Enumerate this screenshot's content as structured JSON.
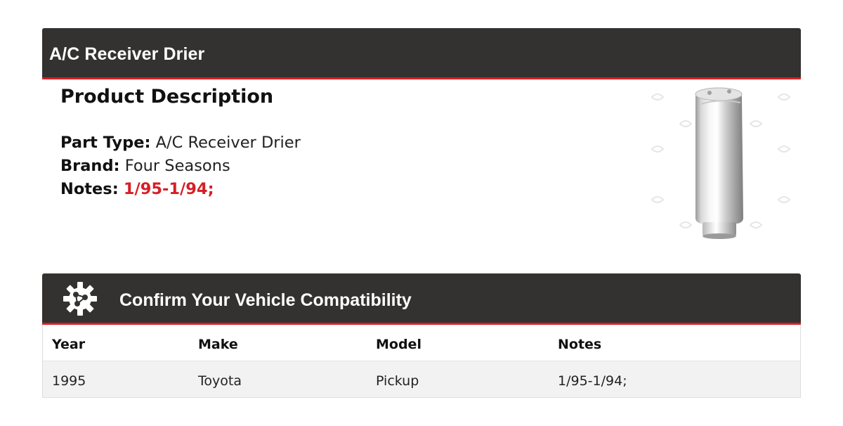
{
  "header": {
    "title": "A/C Receiver Drier"
  },
  "description": {
    "heading": "Product Description",
    "part_type_label": "Part Type:",
    "part_type_value": "A/C Receiver Drier",
    "brand_label": "Brand:",
    "brand_value": "Four Seasons",
    "notes_label": "Notes:",
    "notes_value": "1/95-1/94;"
  },
  "product_image": {
    "icon": "receiver-drier-cylinder"
  },
  "compatibility": {
    "title": "Confirm Your Vehicle Compatibility",
    "icon": "gear-icon",
    "columns": [
      "Year",
      "Make",
      "Model",
      "Notes"
    ],
    "rows": [
      [
        "1995",
        "Toyota",
        "Pickup",
        "1/95-1/94;"
      ]
    ]
  },
  "colors": {
    "bar_background": "#333230",
    "accent_red": "#d61f26",
    "table_row_bg": "#f2f2f2"
  }
}
